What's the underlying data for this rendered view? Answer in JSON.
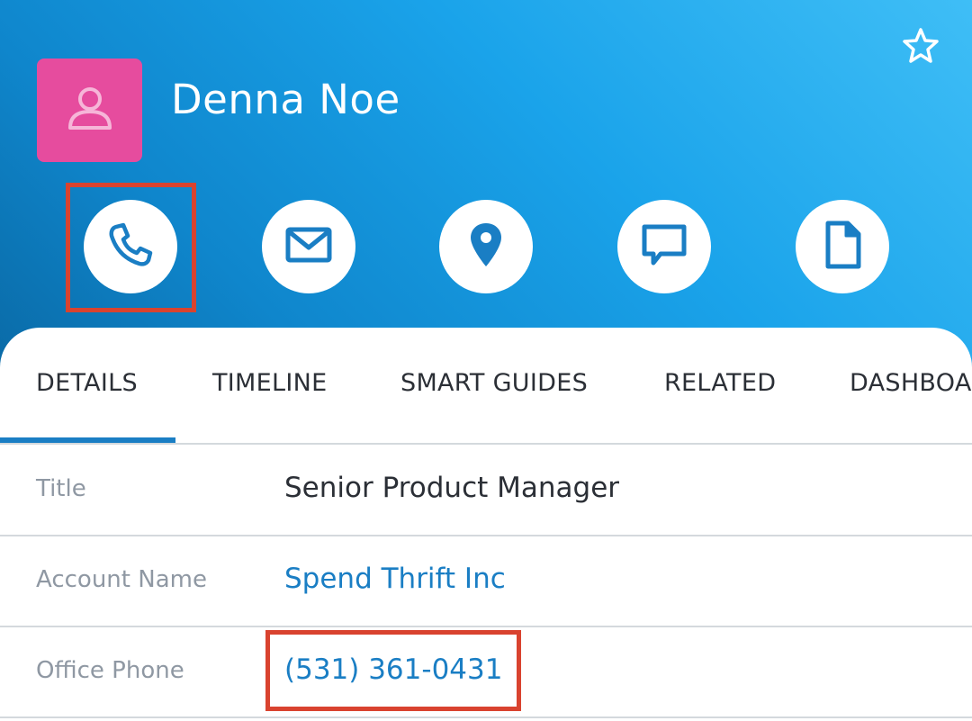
{
  "record": {
    "name": "Denna Noe",
    "avatar_icon": "user-icon",
    "avatar_color": "#e64c9e",
    "favorite_icon": "star-outline-icon"
  },
  "actions": [
    {
      "icon": "phone-icon",
      "highlighted": true
    },
    {
      "icon": "email-icon",
      "highlighted": false
    },
    {
      "icon": "map-pin-icon",
      "highlighted": false
    },
    {
      "icon": "chat-icon",
      "highlighted": false
    },
    {
      "icon": "document-icon",
      "highlighted": false
    }
  ],
  "tabs": [
    {
      "label": "DETAILS",
      "active": true
    },
    {
      "label": "TIMELINE",
      "active": false
    },
    {
      "label": "SMART GUIDES",
      "active": false
    },
    {
      "label": "RELATED",
      "active": false
    },
    {
      "label": "DASHBOARD",
      "active": false
    }
  ],
  "fields": [
    {
      "label": "Title",
      "value": "Senior Product Manager",
      "link": false
    },
    {
      "label": "Account Name",
      "value": "Spend Thrift Inc",
      "link": true
    },
    {
      "label": "Office Phone",
      "value": "(531) 361-0431",
      "link": true,
      "highlighted": true
    }
  ],
  "colors": {
    "accent": "#1a7ec4",
    "highlight_border": "#d9432f",
    "header_gradient_start": "#3fbef6",
    "header_gradient_end": "#0a6aa6"
  }
}
